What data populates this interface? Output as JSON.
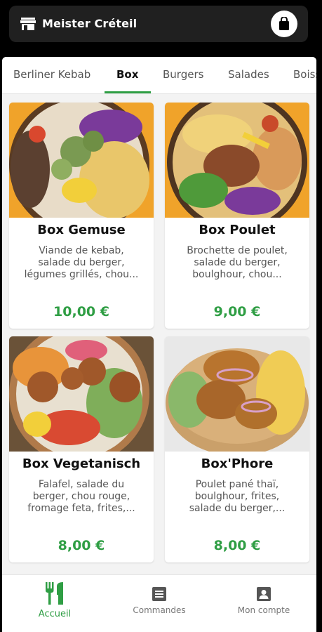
{
  "header": {
    "store_name": "Meister Créteil",
    "icons": {
      "store": "store-icon",
      "cart": "shopping-bag-icon"
    }
  },
  "tabs": [
    {
      "label": "Berliner Kebab",
      "active": false
    },
    {
      "label": "Box",
      "active": true
    },
    {
      "label": "Burgers",
      "active": false
    },
    {
      "label": "Salades",
      "active": false
    },
    {
      "label": "Boissons",
      "active": false
    }
  ],
  "products": [
    {
      "name": "Box Gemuse",
      "description": "Viande de kebab,\nsalade du berger,\nlégumes grillés, chou...",
      "price": "10,00 €"
    },
    {
      "name": "Box Poulet",
      "description": "Brochette de poulet,\nsalade du berger,\nboulghour, chou...",
      "price": "9,00 €"
    },
    {
      "name": "Box Vegetanisch",
      "description": "Falafel, salade du\nberger, chou rouge,\nfromage feta, frites,...",
      "price": "8,00 €"
    },
    {
      "name": "Box'Phore",
      "description": "Poulet pané thaï,\nboulghour, frites,\nsalade du berger,...",
      "price": "8,00 €"
    }
  ],
  "bottom_nav": [
    {
      "label": "Accueil",
      "icon": "cutlery-icon",
      "active": true
    },
    {
      "label": "Commandes",
      "icon": "orders-list-icon",
      "active": false
    },
    {
      "label": "Mon compte",
      "icon": "account-icon",
      "active": false
    }
  ],
  "colors": {
    "accent": "#2f9e44",
    "header_bg": "#202020",
    "page_bg": "#f3f3f3"
  }
}
